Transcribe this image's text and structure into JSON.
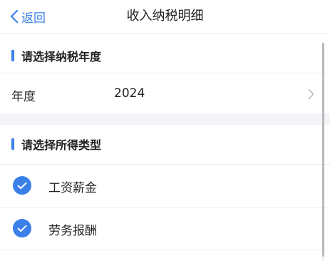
{
  "header": {
    "back_label": "返回",
    "title": "收入纳税明细"
  },
  "year_section": {
    "title": "请选择纳税年度",
    "row_label": "年度",
    "row_value": "2024"
  },
  "income_section": {
    "title": "请选择所得类型",
    "options": [
      {
        "label": "工资薪金",
        "checked": true
      },
      {
        "label": "劳务报酬",
        "checked": true
      }
    ]
  },
  "colors": {
    "accent": "#3a80e8",
    "divider": "#eeeeee",
    "gap_background": "#f3f5f8"
  },
  "icons": [
    "chevron-left-icon",
    "chevron-right-icon",
    "checkmark-icon"
  ]
}
